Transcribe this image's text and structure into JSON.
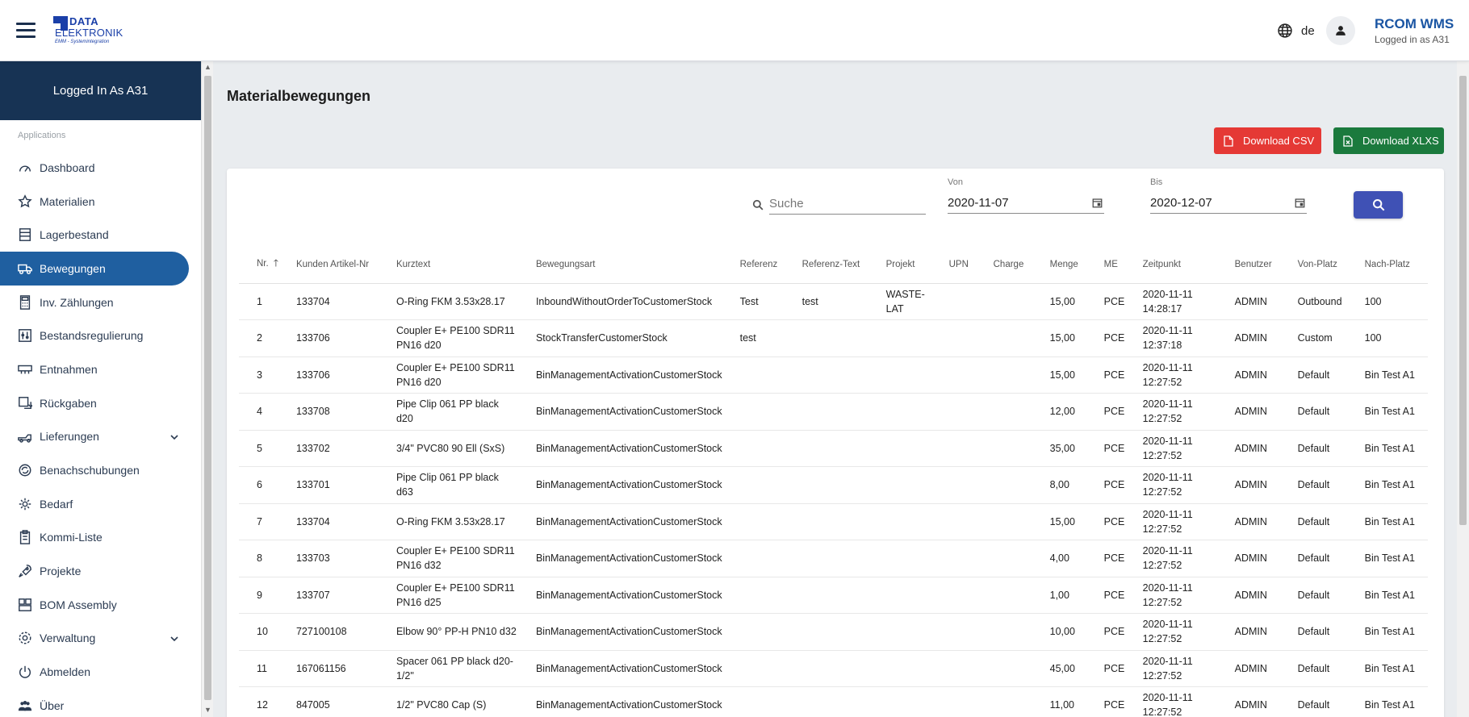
{
  "header": {
    "logo_line1": "DATA",
    "logo_line2": "ELEKTRONIK",
    "logo_line3": "EMM - Systemintegration",
    "language": "de",
    "app_title": "RCOM WMS",
    "logged_in": "Logged in as A31"
  },
  "sidebar": {
    "head": "Logged In As A31",
    "section": "Applications",
    "items": [
      {
        "label": "Dashboard",
        "icon": "gauge-icon"
      },
      {
        "label": "Materialien",
        "icon": "star-icon"
      },
      {
        "label": "Lagerbestand",
        "icon": "shelves-icon"
      },
      {
        "label": "Bewegungen",
        "icon": "truck-icon",
        "active": true
      },
      {
        "label": "Inv. Zählungen",
        "icon": "calculator-icon"
      },
      {
        "label": "Bestandsregulierung",
        "icon": "adjust-icon"
      },
      {
        "label": "Entnahmen",
        "icon": "box-icon"
      },
      {
        "label": "Rückgaben",
        "icon": "return-icon"
      },
      {
        "label": "Lieferungen",
        "icon": "delivery-icon",
        "expandable": true
      },
      {
        "label": "Benachschubungen",
        "icon": "replenish-icon"
      },
      {
        "label": "Bedarf",
        "icon": "demand-icon"
      },
      {
        "label": "Kommi-Liste",
        "icon": "clipboard-icon"
      },
      {
        "label": "Projekte",
        "icon": "rocket-icon"
      },
      {
        "label": "BOM Assembly",
        "icon": "assembly-icon"
      },
      {
        "label": "Verwaltung",
        "icon": "gear-icon",
        "expandable": true
      },
      {
        "label": "Abmelden",
        "icon": "power-icon"
      },
      {
        "label": "Über",
        "icon": "people-icon"
      }
    ]
  },
  "main": {
    "title": "Materialbewegungen",
    "download_csv": "Download CSV",
    "download_xlsx": "Download XLXS",
    "search_placeholder": "Suche",
    "von_label": "Von",
    "von_value": "2020-11-07",
    "bis_label": "Bis",
    "bis_value": "2020-12-07"
  },
  "table": {
    "columns": [
      "Nr.",
      "Kunden Artikel-Nr",
      "Kurztext",
      "Bewegungsart",
      "Referenz",
      "Referenz-Text",
      "Projekt",
      "UPN",
      "Charge",
      "Menge",
      "ME",
      "Zeitpunkt",
      "Benutzer",
      "Von-Platz",
      "Nach-Platz"
    ],
    "rows": [
      [
        "1",
        "133704",
        "O-Ring FKM 3.53x28.17",
        "InboundWithoutOrderToCustomerStock",
        "Test",
        "test",
        "WASTE-LAT",
        "",
        "",
        "15,00",
        "PCE",
        "2020-11-11 14:28:17",
        "ADMIN",
        "Outbound",
        "100"
      ],
      [
        "2",
        "133706",
        "Coupler E+ PE100 SDR11 PN16 d20",
        "StockTransferCustomerStock",
        "test",
        "",
        "",
        "",
        "",
        "15,00",
        "PCE",
        "2020-11-11 12:37:18",
        "ADMIN",
        "Custom",
        "100"
      ],
      [
        "3",
        "133706",
        "Coupler E+ PE100 SDR11 PN16 d20",
        "BinManagementActivationCustomerStock",
        "",
        "",
        "",
        "",
        "",
        "15,00",
        "PCE",
        "2020-11-11 12:27:52",
        "ADMIN",
        "Default",
        "Bin Test A1"
      ],
      [
        "4",
        "133708",
        "Pipe Clip 061 PP black d20",
        "BinManagementActivationCustomerStock",
        "",
        "",
        "",
        "",
        "",
        "12,00",
        "PCE",
        "2020-11-11 12:27:52",
        "ADMIN",
        "Default",
        "Bin Test A1"
      ],
      [
        "5",
        "133702",
        "3/4\" PVC80 90 Ell (SxS)",
        "BinManagementActivationCustomerStock",
        "",
        "",
        "",
        "",
        "",
        "35,00",
        "PCE",
        "2020-11-11 12:27:52",
        "ADMIN",
        "Default",
        "Bin Test A1"
      ],
      [
        "6",
        "133701",
        "Pipe Clip 061 PP black d63",
        "BinManagementActivationCustomerStock",
        "",
        "",
        "",
        "",
        "",
        "8,00",
        "PCE",
        "2020-11-11 12:27:52",
        "ADMIN",
        "Default",
        "Bin Test A1"
      ],
      [
        "7",
        "133704",
        "O-Ring FKM 3.53x28.17",
        "BinManagementActivationCustomerStock",
        "",
        "",
        "",
        "",
        "",
        "15,00",
        "PCE",
        "2020-11-11 12:27:52",
        "ADMIN",
        "Default",
        "Bin Test A1"
      ],
      [
        "8",
        "133703",
        "Coupler E+ PE100 SDR11 PN16 d32",
        "BinManagementActivationCustomerStock",
        "",
        "",
        "",
        "",
        "",
        "4,00",
        "PCE",
        "2020-11-11 12:27:52",
        "ADMIN",
        "Default",
        "Bin Test A1"
      ],
      [
        "9",
        "133707",
        "Coupler E+ PE100 SDR11 PN16 d25",
        "BinManagementActivationCustomerStock",
        "",
        "",
        "",
        "",
        "",
        "1,00",
        "PCE",
        "2020-11-11 12:27:52",
        "ADMIN",
        "Default",
        "Bin Test A1"
      ],
      [
        "10",
        "727100108",
        "Elbow 90° PP-H PN10 d32",
        "BinManagementActivationCustomerStock",
        "",
        "",
        "",
        "",
        "",
        "10,00",
        "PCE",
        "2020-11-11 12:27:52",
        "ADMIN",
        "Default",
        "Bin Test A1"
      ],
      [
        "11",
        "167061156",
        "Spacer 061 PP black d20-1/2\"",
        "BinManagementActivationCustomerStock",
        "",
        "",
        "",
        "",
        "",
        "45,00",
        "PCE",
        "2020-11-11 12:27:52",
        "ADMIN",
        "Default",
        "Bin Test A1"
      ],
      [
        "12",
        "847005",
        "1/2\" PVC80 Cap (S)",
        "BinManagementActivationCustomerStock",
        "",
        "",
        "",
        "",
        "",
        "11,00",
        "PCE",
        "2020-11-11 12:27:52",
        "ADMIN",
        "Default",
        "Bin Test A1"
      ]
    ]
  }
}
